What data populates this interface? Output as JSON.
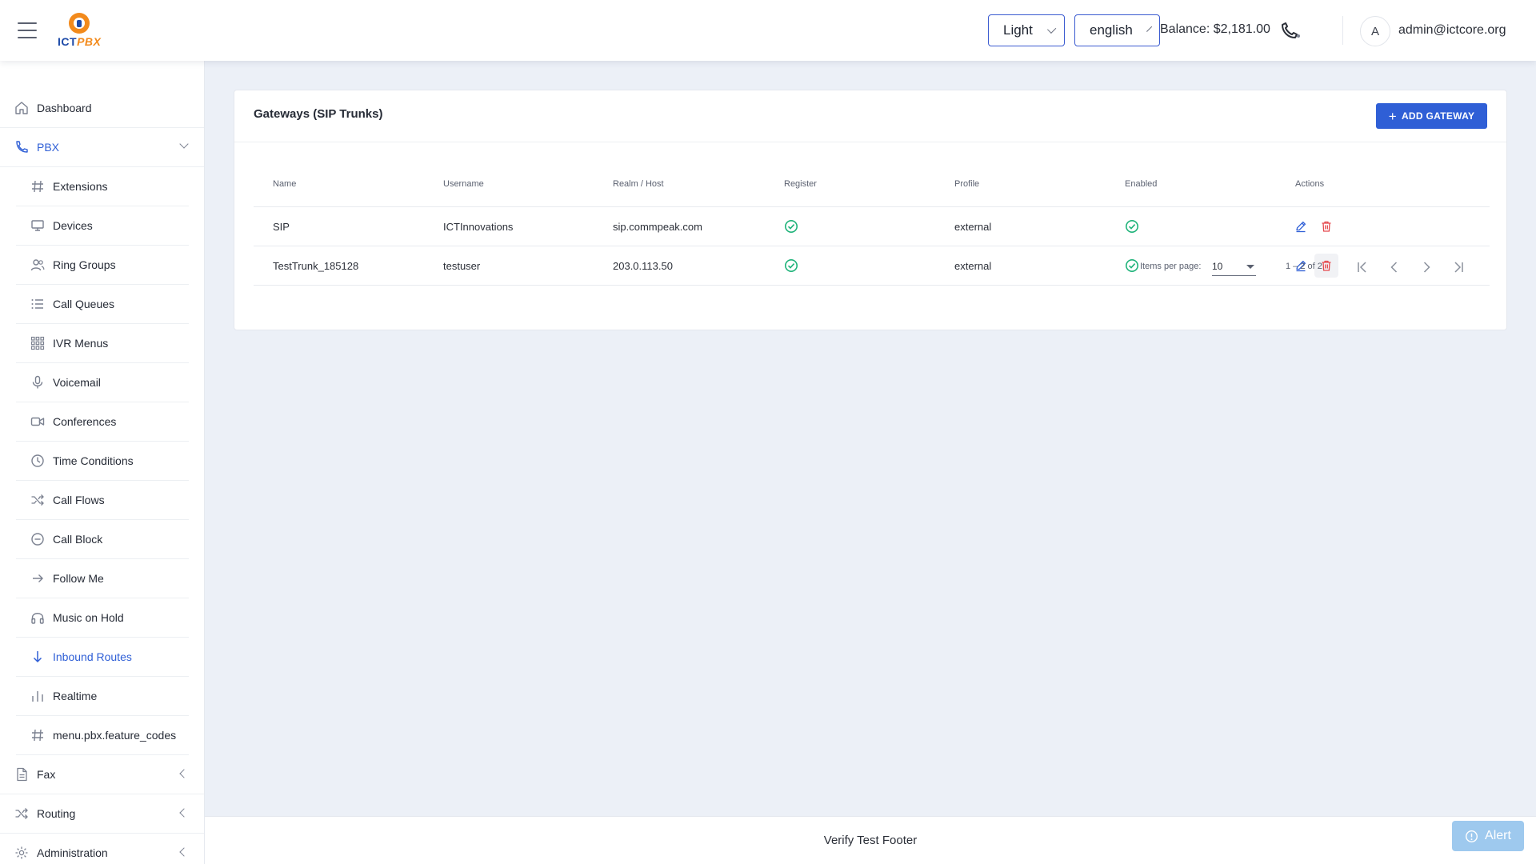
{
  "header": {
    "logo_text_a": "ICT",
    "logo_text_b": "PBX",
    "theme": "Light",
    "language": "english",
    "balance": "Balance: $2,181.00",
    "avatar_initial": "A",
    "user_email": "admin@ictcore.org"
  },
  "sidebar": {
    "dashboard": "Dashboard",
    "pbx": "PBX",
    "pbx_items": [
      "Extensions",
      "Devices",
      "Ring Groups",
      "Call Queues",
      "IVR Menus",
      "Voicemail",
      "Conferences",
      "Time Conditions",
      "Call Flows",
      "Call Block",
      "Follow Me",
      "Music on Hold",
      "Inbound Routes",
      "Realtime",
      "menu.pbx.feature_codes"
    ],
    "fax": "Fax",
    "routing": "Routing",
    "administration": "Administration"
  },
  "card": {
    "title": "Gateways (SIP Trunks)",
    "add_button": "ADD GATEWAY",
    "columns": [
      "Name",
      "Username",
      "Realm / Host",
      "Register",
      "Profile",
      "Enabled",
      "Actions"
    ],
    "rows": [
      {
        "name": "SIP",
        "username": "ICTInnovations",
        "host": "sip.commpeak.com",
        "register": true,
        "profile": "external",
        "enabled": true
      },
      {
        "name": "TestTrunk_185128",
        "username": "testuser",
        "host": "203.0.113.50",
        "register": true,
        "profile": "external",
        "enabled": true
      }
    ],
    "pager": {
      "items_per_page_label": "Items per page:",
      "items_per_page": "10",
      "range": "1 – 2 of 2"
    }
  },
  "footer": {
    "text": "Verify Test Footer"
  },
  "alert": {
    "label": "Alert"
  },
  "colors": {
    "accent": "#2f5fd6",
    "success": "#1fb37a",
    "danger": "#e5484d",
    "alert_bg": "#9ec9ee"
  }
}
